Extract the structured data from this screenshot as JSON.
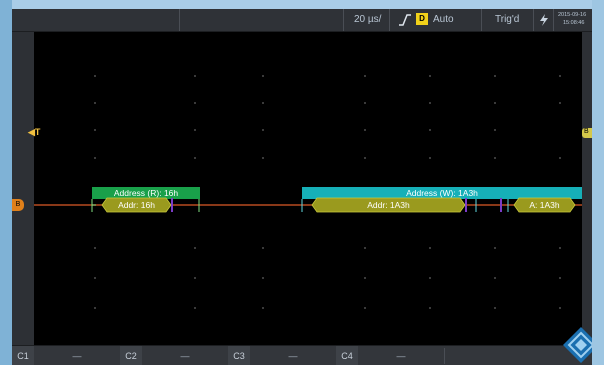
{
  "topbar": {
    "timebase": "20 µs/",
    "trigger_source": "D",
    "trigger_mode": "Auto",
    "trigger_status": "Trig'd",
    "date": "2015-09-16",
    "time": "15:08:46"
  },
  "markers": {
    "trigger_position": "T",
    "right_edge": "B",
    "bus_label": "B"
  },
  "decode": {
    "frame1": {
      "header": "Address (R): 16h",
      "pill": "Addr: 16h"
    },
    "frame2": {
      "header": "Address (W): 1A3h",
      "pill": "Addr: 1A3h",
      "pill2": "A: 1A3h"
    }
  },
  "channels": [
    {
      "label": "C1",
      "value": "—"
    },
    {
      "label": "C2",
      "value": "—"
    },
    {
      "label": "C3",
      "value": "—"
    },
    {
      "label": "C4",
      "value": "—"
    }
  ],
  "colors": {
    "frame1_green": "#19a04a",
    "frame2_teal": "#16b0b8",
    "pill_olive": "#9a9a1e",
    "trace_orange": "#b84a20",
    "marker_violet": "#7a3cc8"
  }
}
